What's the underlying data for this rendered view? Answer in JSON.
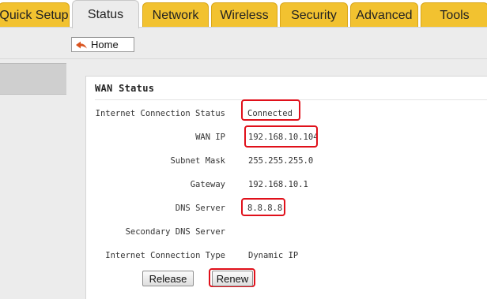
{
  "tabs": [
    {
      "label": "Quick Setup"
    },
    {
      "label": "Status"
    },
    {
      "label": "Network"
    },
    {
      "label": "Wireless"
    },
    {
      "label": "Security"
    },
    {
      "label": "Advanced"
    },
    {
      "label": "Tools"
    }
  ],
  "active_tab": "Status",
  "breadcrumb": {
    "home_label": "Home",
    "icon": "home-arrow-icon"
  },
  "wan": {
    "title": "WAN Status",
    "rows": [
      {
        "label": "Internet Connection Status",
        "value": "Connected"
      },
      {
        "label": "WAN IP",
        "value": "192.168.10.104"
      },
      {
        "label": "Subnet Mask",
        "value": "255.255.255.0"
      },
      {
        "label": "Gateway",
        "value": "192.168.10.1"
      },
      {
        "label": "DNS Server",
        "value": "8.8.8.8"
      },
      {
        "label": "Secondary DNS Server",
        "value": ""
      },
      {
        "label": "Internet Connection Type",
        "value": "Dynamic IP"
      }
    ],
    "release_label": "Release",
    "renew_label": "Renew"
  },
  "colors": {
    "tab": "#f2c230",
    "active_tab": "#ececec",
    "highlight": "#e0101a",
    "home_icon": "#d9531e"
  }
}
